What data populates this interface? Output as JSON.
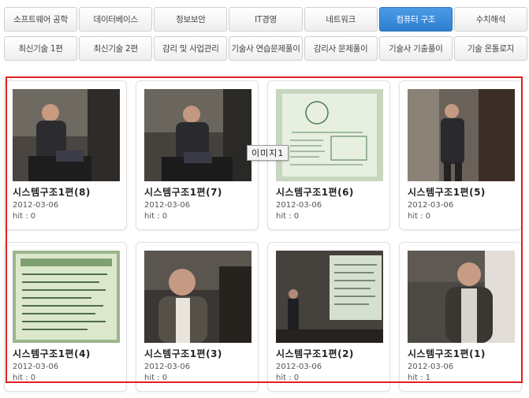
{
  "tabs_row1": [
    {
      "label": "소프트웨어 공학",
      "active": false
    },
    {
      "label": "데이터베이스",
      "active": false
    },
    {
      "label": "정보보안",
      "active": false
    },
    {
      "label": "IT경영",
      "active": false
    },
    {
      "label": "네트워크",
      "active": false
    },
    {
      "label": "컴퓨터 구조",
      "active": true
    },
    {
      "label": "수치해석",
      "active": false
    }
  ],
  "tabs_row2": [
    {
      "label": "최신기술 1편"
    },
    {
      "label": "최신기술 2편"
    },
    {
      "label": "감리 및 사업관리"
    },
    {
      "label": "기술사 연습문제풀이"
    },
    {
      "label": "감리사 문제풀이"
    },
    {
      "label": "기술사 기출풀이"
    },
    {
      "label": "기술 온톨로지"
    }
  ],
  "colors": {
    "accent": "#3a8ee0",
    "highlight_frame": "#e02020"
  },
  "videos": [
    {
      "title": "시스템구조1편(8)",
      "date": "2012-03-06",
      "hit": "hit : 0",
      "thumb": "presenter-laptop"
    },
    {
      "title": "시스템구조1편(7)",
      "date": "2012-03-06",
      "hit": "hit : 0",
      "thumb": "presenter-gesture"
    },
    {
      "title": "시스템구조1편(6)",
      "date": "2012-03-06",
      "hit": "hit : 0",
      "thumb": "slide-diagram"
    },
    {
      "title": "시스템구조1편(5)",
      "date": "2012-03-06",
      "hit": "hit : 0",
      "thumb": "presenter-standing"
    },
    {
      "title": "시스템구조1편(4)",
      "date": "2012-03-06",
      "hit": "hit : 0",
      "thumb": "slide-text"
    },
    {
      "title": "시스템구조1편(3)",
      "date": "2012-03-06",
      "hit": "hit : 0",
      "thumb": "presenter-closeup"
    },
    {
      "title": "시스템구조1편(2)",
      "date": "2012-03-06",
      "hit": "hit : 0",
      "thumb": "room-screen"
    },
    {
      "title": "시스템구조1편(1)",
      "date": "2012-03-06",
      "hit": "hit : 1",
      "thumb": "presenter-screen"
    }
  ],
  "tooltip": "이미지1"
}
